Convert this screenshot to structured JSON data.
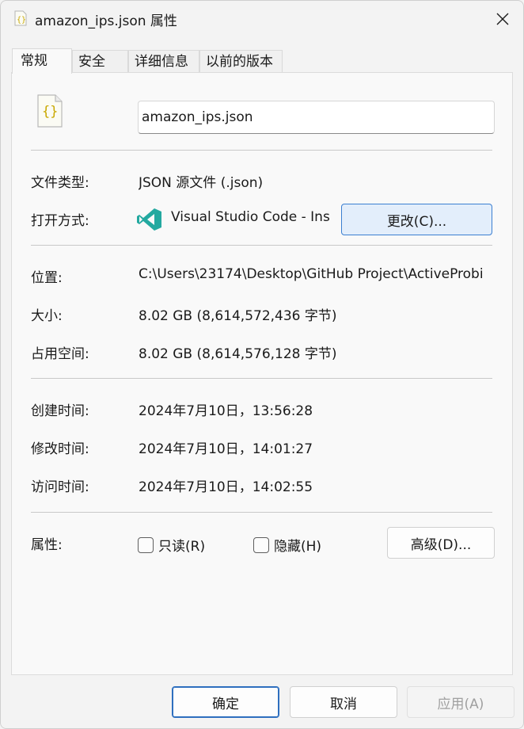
{
  "window": {
    "title": "amazon_ips.json 属性"
  },
  "tabs": [
    {
      "label": "常规",
      "active": true
    },
    {
      "label": "安全",
      "active": false
    },
    {
      "label": "详细信息",
      "active": false
    },
    {
      "label": "以前的版本",
      "active": false
    }
  ],
  "file": {
    "name": "amazon_ips.json",
    "icon": "json-file-icon"
  },
  "type": {
    "label": "文件类型:",
    "value": "JSON 源文件 (.json)"
  },
  "opens_with": {
    "label": "打开方式:",
    "value": "Visual Studio Code - Ins",
    "icon": "vscode-icon",
    "change_label": "更改(C)..."
  },
  "location": {
    "label": "位置:",
    "value": "C:\\Users\\23174\\Desktop\\GitHub Project\\ActiveProbi"
  },
  "size": {
    "label": "大小:",
    "value": "8.02 GB (8,614,572,436 字节)"
  },
  "size_on_disk": {
    "label": "占用空间:",
    "value": "8.02 GB (8,614,576,128 字节)"
  },
  "created": {
    "label": "创建时间:",
    "value": "2024年7月10日，13:56:28"
  },
  "modified": {
    "label": "修改时间:",
    "value": "2024年7月10日，14:01:27"
  },
  "accessed": {
    "label": "访问时间:",
    "value": "2024年7月10日，14:02:55"
  },
  "attributes": {
    "label": "属性:",
    "readonly": {
      "label": "只读(R)",
      "checked": false
    },
    "hidden": {
      "label": "隐藏(H)",
      "checked": false
    },
    "advanced_label": "高级(D)..."
  },
  "footer": {
    "ok": "确定",
    "cancel": "取消",
    "apply": "应用(A)"
  },
  "colors": {
    "accent": "#3b7fd1",
    "json_icon": "#c9a800",
    "vscode": "#23a9a0"
  }
}
